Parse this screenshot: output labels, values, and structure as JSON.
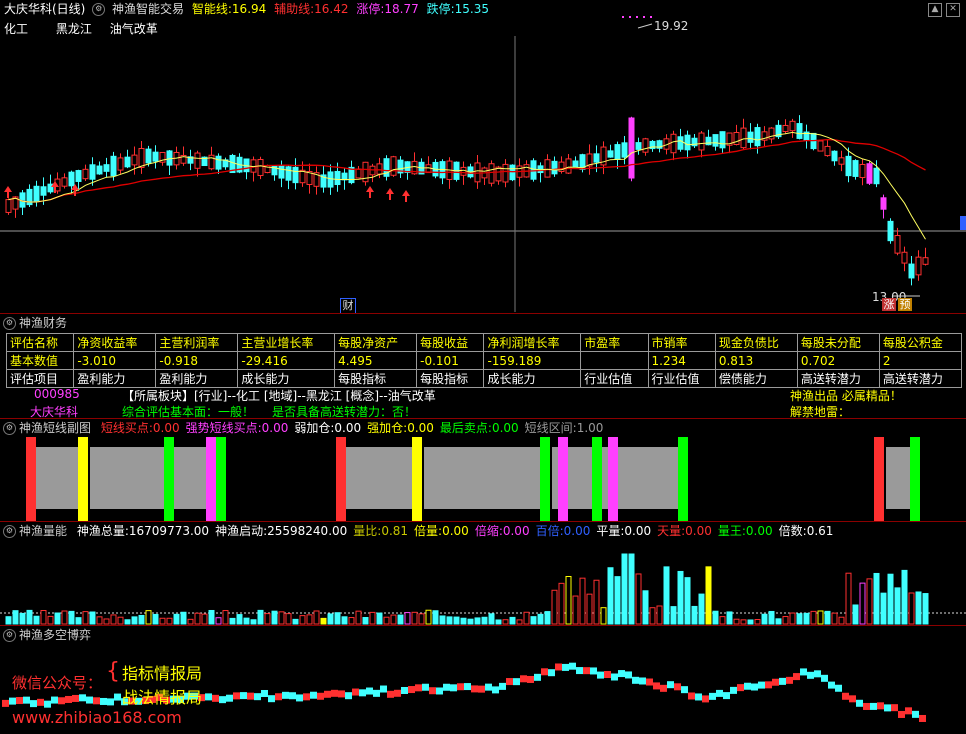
{
  "header": {
    "stock_name": "大庆华科(日线)",
    "indicator": "神渔智能交易",
    "zhineng_label": "智能线:",
    "zhineng_value": "16.94",
    "fuzhu_label": "辅助线:",
    "fuzhu_value": "16.42",
    "zhangting_label": "涨停:",
    "zhangting_value": "18.77",
    "dieting_label": "跌停:",
    "dieting_value": "15.35",
    "concepts": [
      "化工",
      "黑龙江",
      "油气改革"
    ],
    "high_label": "19.92",
    "low_label": "13.00",
    "cai_label": "财",
    "zhang_label": "涨",
    "yu_label": "预"
  },
  "finance": {
    "title": "神渔财务",
    "headers": [
      "评估名称",
      "净资收益率",
      "主营利润率",
      "主营业增长率",
      "每股净资产",
      "每股收益",
      "净利润增长率",
      "市盈率",
      "市销率",
      "现金负债比",
      "每股未分配",
      "每股公积金"
    ],
    "basic_row": [
      "基本数值",
      "-3.010",
      "-0.918",
      "-29.416",
      "4.495",
      "-0.101",
      "-159.189",
      "",
      "1.234",
      "0.813",
      "0.702",
      "2"
    ],
    "eval_row": [
      "评估项目",
      "盈利能力",
      "盈利能力",
      "成长能力",
      "每股指标",
      "每股指标",
      "成长能力",
      "行业估值",
      "行业估值",
      "偿债能力",
      "高送转潜力",
      "高送转潜力"
    ],
    "code": "000985",
    "name": "大庆华科",
    "plate_line": "【所属板块】[行业]--化工 [地域]--黑龙江 [概念]--油气改革",
    "eval_line": "综合评估基本面：一般！",
    "gaosong_line": "是否具备高送转潜力：否！",
    "brand": "神渔出品 必属精品！",
    "jiejin": "解禁地雷："
  },
  "short_panel": {
    "title": "神渔短线副图",
    "items": [
      {
        "label": "短线买点:",
        "value": "0.00",
        "color": "#ff3030"
      },
      {
        "label": "强势短线买点:",
        "value": "0.00",
        "color": "#ff40ff"
      },
      {
        "label": "弱加仓:",
        "value": "0.00",
        "color": "#ffffff"
      },
      {
        "label": "强加仓:",
        "value": "0.00",
        "color": "#ffff00"
      },
      {
        "label": "最后卖点:",
        "value": "0.00",
        "color": "#00ff00"
      },
      {
        "label": "短线区间:",
        "value": "1.00",
        "color": "#9a9a9a"
      }
    ]
  },
  "volume_panel": {
    "title": "神渔量能",
    "items": [
      {
        "label": "神渔总量:",
        "value": "16709773.00",
        "color": "#ffffff"
      },
      {
        "label": "神渔启动:",
        "value": "25598240.00",
        "color": "#ffffff"
      },
      {
        "label": "量比:",
        "value": "0.81",
        "color": "#c8c800"
      },
      {
        "label": "倍量:",
        "value": "0.00",
        "color": "#ffff00"
      },
      {
        "label": "倍缩:",
        "value": "0.00",
        "color": "#ff40ff"
      },
      {
        "label": "百倍:",
        "value": "0.00",
        "color": "#3060ff"
      },
      {
        "label": "平量:",
        "value": "0.00",
        "color": "#ffffff"
      },
      {
        "label": "天量:",
        "value": "0.00",
        "color": "#ff3030"
      },
      {
        "label": "量王:",
        "value": "0.00",
        "color": "#00ff00"
      },
      {
        "label": "倍数:",
        "value": "0.61",
        "color": "#ffffff"
      }
    ]
  },
  "duokong_panel": {
    "title": "神渔多空博弈"
  },
  "watermark": {
    "wechat": "微信公众号：",
    "line1": "指标情报局",
    "line2": "战法情报局",
    "url": "www.zhibiao168.com"
  },
  "colors": {
    "up": "#ff3030",
    "down": "#40ffff",
    "ma_fast": "#ffff60",
    "ma_slow": "#e00000"
  }
}
